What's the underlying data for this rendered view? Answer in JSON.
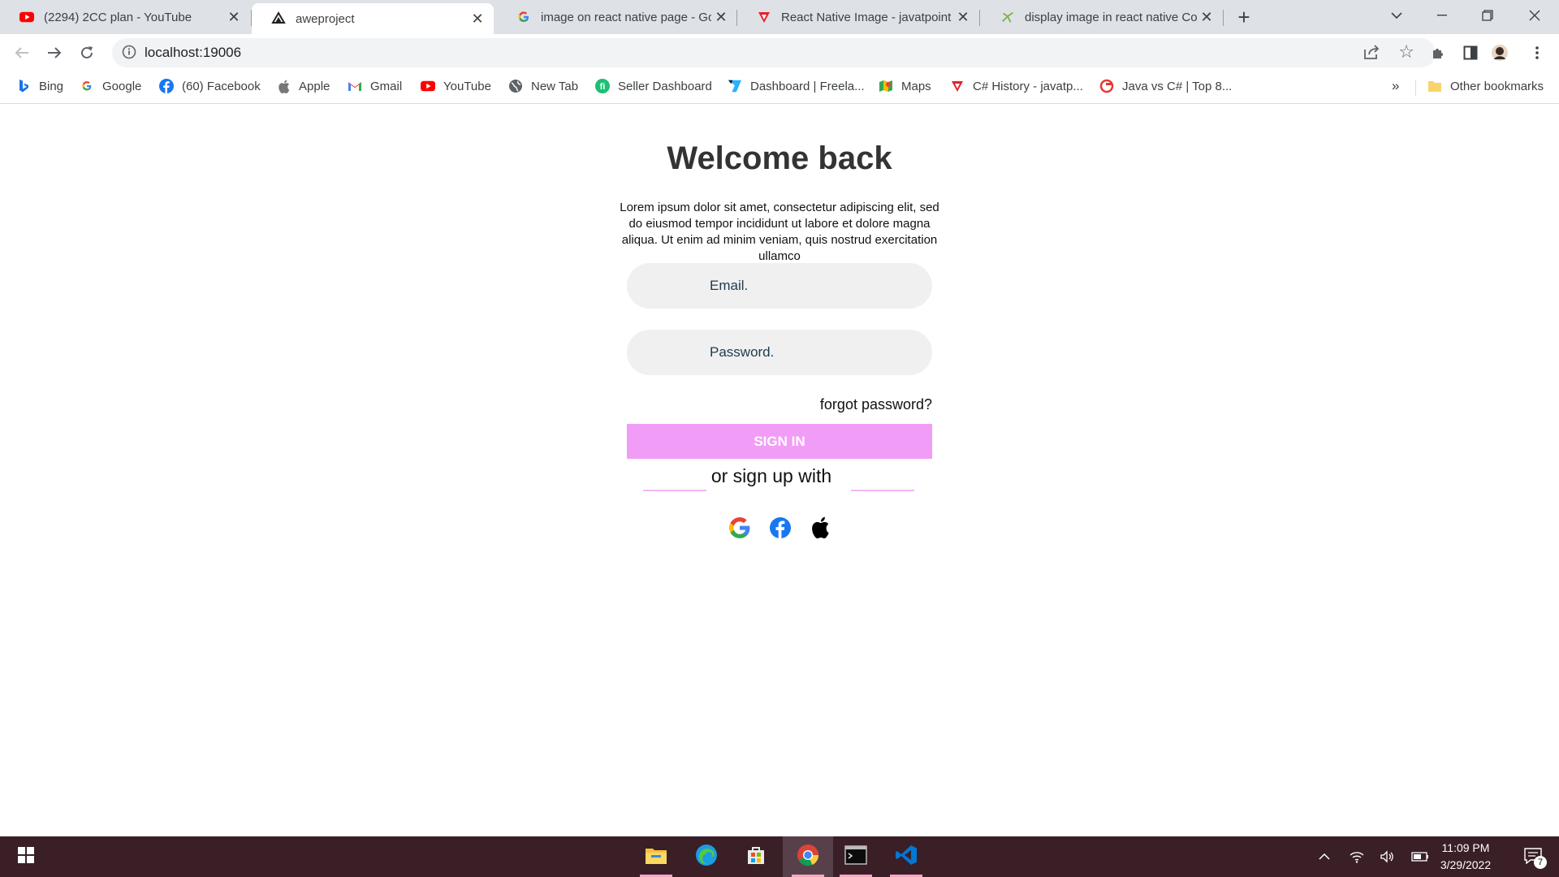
{
  "browser": {
    "tabs": [
      {
        "title": "(2294) 2CC plan - YouTube",
        "icon": "youtube-icon",
        "active": false
      },
      {
        "title": "aweproject",
        "icon": "expo-icon",
        "active": true
      },
      {
        "title": "image on react native page - Goo",
        "icon": "google-icon",
        "active": false
      },
      {
        "title": "React Native Image - javatpoint",
        "icon": "javatpoint-icon",
        "active": false
      },
      {
        "title": "display image in react native Cod",
        "icon": "codegrepper-icon",
        "active": false
      }
    ],
    "url": "localhost:19006",
    "bookmarks": [
      {
        "label": "Bing",
        "icon": "bing-icon"
      },
      {
        "label": "Google",
        "icon": "google-icon"
      },
      {
        "label": "(60) Facebook",
        "icon": "facebook-icon"
      },
      {
        "label": "Apple",
        "icon": "apple-icon"
      },
      {
        "label": "Gmail",
        "icon": "gmail-icon"
      },
      {
        "label": "YouTube",
        "icon": "youtube-icon"
      },
      {
        "label": "New Tab",
        "icon": "globe-icon"
      },
      {
        "label": "Seller Dashboard",
        "icon": "fiverr-icon"
      },
      {
        "label": "Dashboard | Freela...",
        "icon": "freelancer-icon"
      },
      {
        "label": "Maps",
        "icon": "maps-icon"
      },
      {
        "label": "C# History - javatp...",
        "icon": "javatpoint-icon"
      },
      {
        "label": "Java vs C# | Top 8...",
        "icon": "educba-icon"
      }
    ],
    "bookmarks_more": "»",
    "other_bookmarks": "Other bookmarks"
  },
  "page": {
    "heading": "Welcome back",
    "description": "Lorem ipsum dolor sit amet, consectetur adipiscing elit, sed do eiusmod tempor incididunt ut labore et dolore magna aliqua. Ut enim ad minim veniam, quis nostrud exercitation ullamco",
    "email_placeholder": "Email.",
    "password_placeholder": "Password.",
    "forgot_password": "forgot password?",
    "sign_in_label": "SIGN IN",
    "or_sign_up": "or sign up with",
    "social_icons": [
      "google-icon",
      "facebook-icon",
      "apple-icon"
    ]
  },
  "colors": {
    "sign_in_button": "#f19df7",
    "input_bg": "#f0f0f0",
    "divider": "#f5b6f8",
    "taskbar": "#3a1f27"
  },
  "taskbar": {
    "apps": [
      "file-explorer-icon",
      "edge-icon",
      "store-icon",
      "chrome-icon",
      "terminal-icon",
      "vscode-icon"
    ],
    "time": "11:09 PM",
    "date": "3/29/2022",
    "notification_count": "7"
  }
}
